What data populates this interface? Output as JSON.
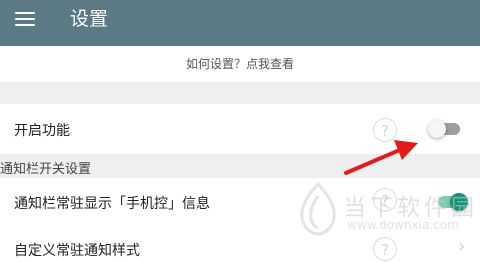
{
  "app_bar": {
    "title": "设置",
    "menu_icon": "hamburger-menu-icon",
    "background": "#5b7a86"
  },
  "help_link": {
    "label": "如何设置？点我查看"
  },
  "settings": {
    "feature": {
      "label": "开启功能",
      "help_icon": "question-icon",
      "toggle": "off"
    },
    "section_header": "通知栏开关设置",
    "notify": {
      "label": "通知栏常驻显示「手机控」信息",
      "help_icon": "question-icon",
      "toggle": "on"
    },
    "custom": {
      "label": "自定义常驻通知样式",
      "help_icon": "question-icon",
      "chevron": "chevron-right-icon"
    }
  },
  "annotation": {
    "arrow_color": "#e21c1c"
  },
  "watermark": {
    "text": "当下软件园",
    "url": "www.downxia.com"
  },
  "colors": {
    "accent": "#14937a",
    "section_bg": "#efefef"
  }
}
